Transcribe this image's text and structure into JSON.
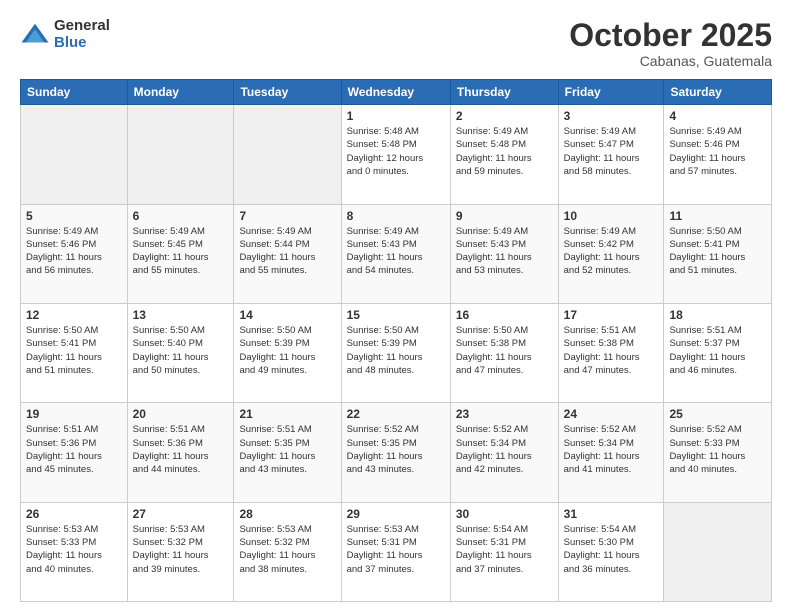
{
  "logo": {
    "general": "General",
    "blue": "Blue"
  },
  "header": {
    "month": "October 2025",
    "location": "Cabanas, Guatemala"
  },
  "days_of_week": [
    "Sunday",
    "Monday",
    "Tuesday",
    "Wednesday",
    "Thursday",
    "Friday",
    "Saturday"
  ],
  "weeks": [
    [
      {
        "day": "",
        "info": ""
      },
      {
        "day": "",
        "info": ""
      },
      {
        "day": "",
        "info": ""
      },
      {
        "day": "1",
        "info": "Sunrise: 5:48 AM\nSunset: 5:48 PM\nDaylight: 12 hours\nand 0 minutes."
      },
      {
        "day": "2",
        "info": "Sunrise: 5:49 AM\nSunset: 5:48 PM\nDaylight: 11 hours\nand 59 minutes."
      },
      {
        "day": "3",
        "info": "Sunrise: 5:49 AM\nSunset: 5:47 PM\nDaylight: 11 hours\nand 58 minutes."
      },
      {
        "day": "4",
        "info": "Sunrise: 5:49 AM\nSunset: 5:46 PM\nDaylight: 11 hours\nand 57 minutes."
      }
    ],
    [
      {
        "day": "5",
        "info": "Sunrise: 5:49 AM\nSunset: 5:46 PM\nDaylight: 11 hours\nand 56 minutes."
      },
      {
        "day": "6",
        "info": "Sunrise: 5:49 AM\nSunset: 5:45 PM\nDaylight: 11 hours\nand 55 minutes."
      },
      {
        "day": "7",
        "info": "Sunrise: 5:49 AM\nSunset: 5:44 PM\nDaylight: 11 hours\nand 55 minutes."
      },
      {
        "day": "8",
        "info": "Sunrise: 5:49 AM\nSunset: 5:43 PM\nDaylight: 11 hours\nand 54 minutes."
      },
      {
        "day": "9",
        "info": "Sunrise: 5:49 AM\nSunset: 5:43 PM\nDaylight: 11 hours\nand 53 minutes."
      },
      {
        "day": "10",
        "info": "Sunrise: 5:49 AM\nSunset: 5:42 PM\nDaylight: 11 hours\nand 52 minutes."
      },
      {
        "day": "11",
        "info": "Sunrise: 5:50 AM\nSunset: 5:41 PM\nDaylight: 11 hours\nand 51 minutes."
      }
    ],
    [
      {
        "day": "12",
        "info": "Sunrise: 5:50 AM\nSunset: 5:41 PM\nDaylight: 11 hours\nand 51 minutes."
      },
      {
        "day": "13",
        "info": "Sunrise: 5:50 AM\nSunset: 5:40 PM\nDaylight: 11 hours\nand 50 minutes."
      },
      {
        "day": "14",
        "info": "Sunrise: 5:50 AM\nSunset: 5:39 PM\nDaylight: 11 hours\nand 49 minutes."
      },
      {
        "day": "15",
        "info": "Sunrise: 5:50 AM\nSunset: 5:39 PM\nDaylight: 11 hours\nand 48 minutes."
      },
      {
        "day": "16",
        "info": "Sunrise: 5:50 AM\nSunset: 5:38 PM\nDaylight: 11 hours\nand 47 minutes."
      },
      {
        "day": "17",
        "info": "Sunrise: 5:51 AM\nSunset: 5:38 PM\nDaylight: 11 hours\nand 47 minutes."
      },
      {
        "day": "18",
        "info": "Sunrise: 5:51 AM\nSunset: 5:37 PM\nDaylight: 11 hours\nand 46 minutes."
      }
    ],
    [
      {
        "day": "19",
        "info": "Sunrise: 5:51 AM\nSunset: 5:36 PM\nDaylight: 11 hours\nand 45 minutes."
      },
      {
        "day": "20",
        "info": "Sunrise: 5:51 AM\nSunset: 5:36 PM\nDaylight: 11 hours\nand 44 minutes."
      },
      {
        "day": "21",
        "info": "Sunrise: 5:51 AM\nSunset: 5:35 PM\nDaylight: 11 hours\nand 43 minutes."
      },
      {
        "day": "22",
        "info": "Sunrise: 5:52 AM\nSunset: 5:35 PM\nDaylight: 11 hours\nand 43 minutes."
      },
      {
        "day": "23",
        "info": "Sunrise: 5:52 AM\nSunset: 5:34 PM\nDaylight: 11 hours\nand 42 minutes."
      },
      {
        "day": "24",
        "info": "Sunrise: 5:52 AM\nSunset: 5:34 PM\nDaylight: 11 hours\nand 41 minutes."
      },
      {
        "day": "25",
        "info": "Sunrise: 5:52 AM\nSunset: 5:33 PM\nDaylight: 11 hours\nand 40 minutes."
      }
    ],
    [
      {
        "day": "26",
        "info": "Sunrise: 5:53 AM\nSunset: 5:33 PM\nDaylight: 11 hours\nand 40 minutes."
      },
      {
        "day": "27",
        "info": "Sunrise: 5:53 AM\nSunset: 5:32 PM\nDaylight: 11 hours\nand 39 minutes."
      },
      {
        "day": "28",
        "info": "Sunrise: 5:53 AM\nSunset: 5:32 PM\nDaylight: 11 hours\nand 38 minutes."
      },
      {
        "day": "29",
        "info": "Sunrise: 5:53 AM\nSunset: 5:31 PM\nDaylight: 11 hours\nand 37 minutes."
      },
      {
        "day": "30",
        "info": "Sunrise: 5:54 AM\nSunset: 5:31 PM\nDaylight: 11 hours\nand 37 minutes."
      },
      {
        "day": "31",
        "info": "Sunrise: 5:54 AM\nSunset: 5:30 PM\nDaylight: 11 hours\nand 36 minutes."
      },
      {
        "day": "",
        "info": ""
      }
    ]
  ]
}
